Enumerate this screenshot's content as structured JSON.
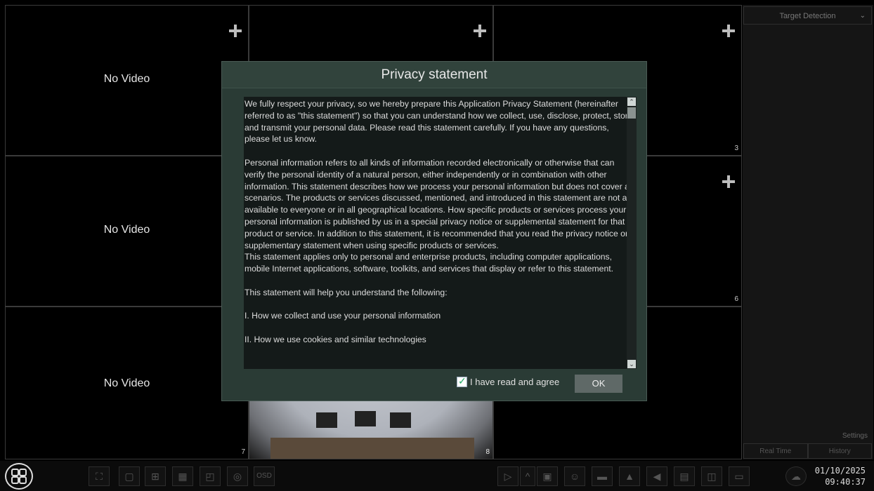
{
  "cells": [
    {
      "label": "No Video",
      "num": ""
    },
    {
      "label": "",
      "num": ""
    },
    {
      "label": "",
      "num": "3"
    },
    {
      "label": "No Video",
      "num": ""
    },
    {
      "label": "",
      "num": ""
    },
    {
      "label": "",
      "num": "6"
    },
    {
      "label": "No Video",
      "num": "7"
    },
    {
      "label": "",
      "num": "8"
    },
    {
      "label": "",
      "num": ""
    }
  ],
  "panel": {
    "dropdown": "Target Detection",
    "settings": "Settings",
    "tab_realtime": "Real Time",
    "tab_history": "History"
  },
  "dialog": {
    "title": "Privacy statement",
    "paragraphs": [
      "We fully respect your privacy, so we hereby prepare this Application Privacy Statement (hereinafter referred to as \"this statement\") so that you can understand how we collect, use, disclose, protect, store, and transmit your personal data. Please read this statement carefully. If you have any questions, please let us know.",
      "",
      "Personal information refers to all kinds of information recorded electronically or otherwise that can verify the personal identity of a natural person, either independently or in combination with other information. This statement describes how we process your personal information but does not cover all scenarios. The products or services discussed, mentioned, and introduced in this statement are not all available to everyone or in all geographical locations. How specific products or services process your personal information is published by us in a special privacy notice or supplemental statement for that product or service. In addition to this statement, it is recommended that you read the privacy notice or supplementary statement when using specific products or services.",
      "This statement applies only to personal and enterprise products, including computer applications, mobile Internet applications, software, toolkits, and services that display or refer to this statement.",
      "",
      "This statement will help you understand the following:",
      "",
      "I. How we collect and use your personal information",
      "",
      "II. How we use cookies and similar technologies"
    ],
    "agree_label": "I have read and agree",
    "ok_label": "OK"
  },
  "taskbar": {
    "osd_label": "OSD",
    "date": "01/10/2025",
    "time": "09:40:37"
  }
}
